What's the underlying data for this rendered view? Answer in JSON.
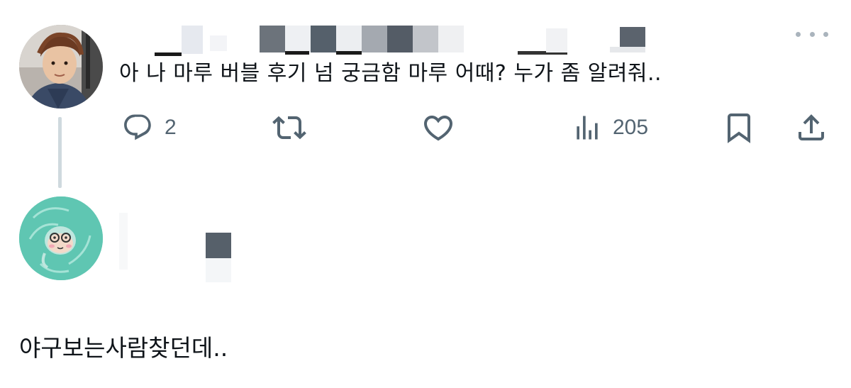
{
  "tweet": {
    "text": "아 나 마루 버블 후기 넘 궁금함 마루 어때? 누가 좀 알려줘..",
    "actions": {
      "reply_count": "2",
      "retweet_count": "",
      "like_count": "",
      "views_count": "205"
    },
    "icons": {
      "more": "more-dots-icon",
      "reply": "reply-bubble-icon",
      "retweet": "retweet-icon",
      "like": "heart-icon",
      "views": "views-chart-icon",
      "bookmark": "bookmark-icon",
      "share": "share-icon"
    }
  },
  "reply": {
    "text": "야구보는사람찾던데.."
  },
  "colors": {
    "icon_gray": "#536471",
    "thread_line": "#cfd9de",
    "text": "#0f1419"
  }
}
